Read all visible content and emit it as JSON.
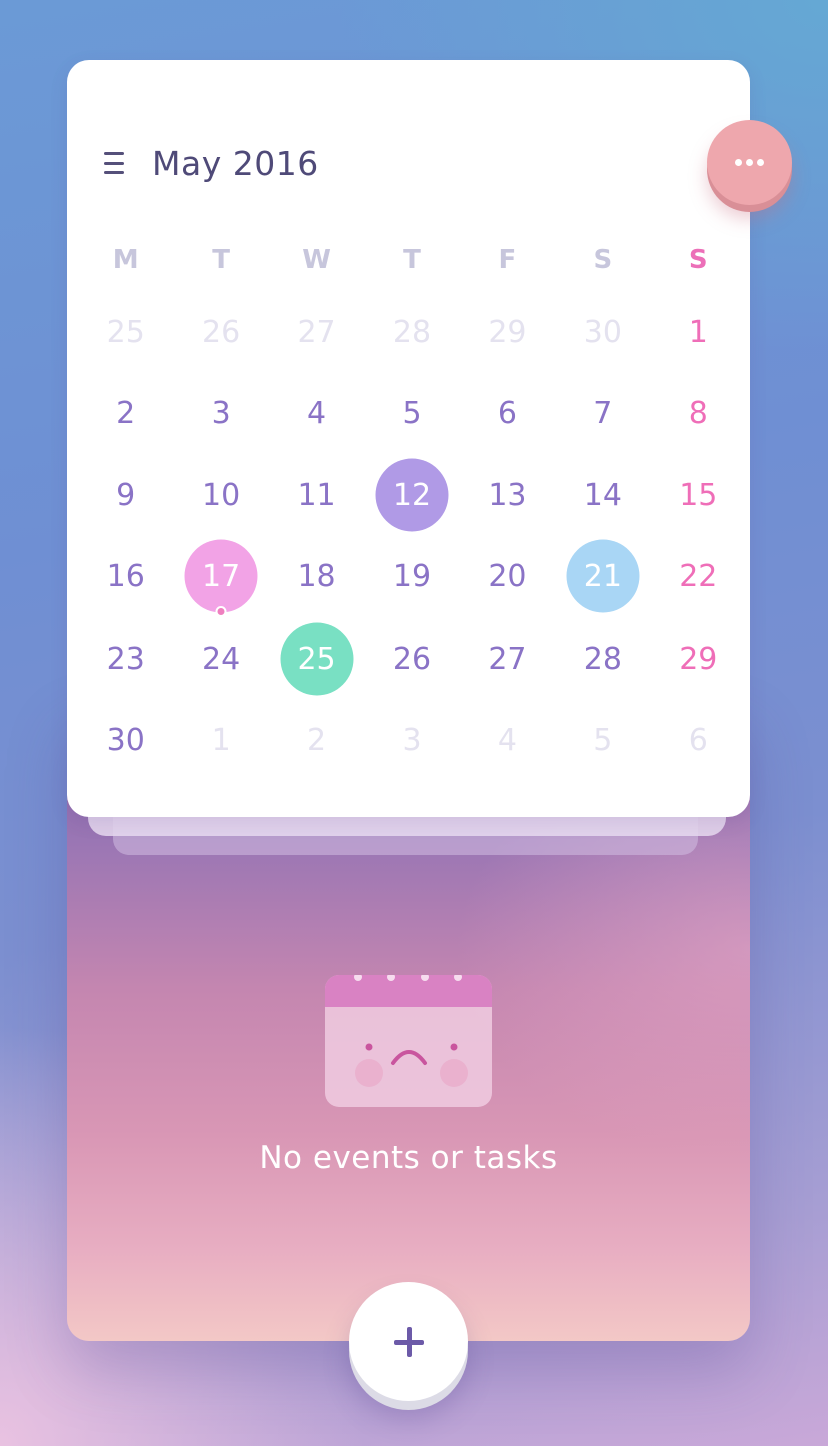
{
  "calendar": {
    "month_title": "May 2016",
    "weekdays": [
      "M",
      "T",
      "W",
      "T",
      "F",
      "S",
      "S"
    ],
    "weeks": [
      [
        {
          "d": "25",
          "muted": true
        },
        {
          "d": "26",
          "muted": true
        },
        {
          "d": "27",
          "muted": true
        },
        {
          "d": "28",
          "muted": true
        },
        {
          "d": "29",
          "muted": true
        },
        {
          "d": "30",
          "muted": true
        },
        {
          "d": "1"
        }
      ],
      [
        {
          "d": "2"
        },
        {
          "d": "3"
        },
        {
          "d": "4"
        },
        {
          "d": "5"
        },
        {
          "d": "6"
        },
        {
          "d": "7"
        },
        {
          "d": "8"
        }
      ],
      [
        {
          "d": "9"
        },
        {
          "d": "10"
        },
        {
          "d": "11"
        },
        {
          "d": "12",
          "highlight": "#b09ae6"
        },
        {
          "d": "13"
        },
        {
          "d": "14"
        },
        {
          "d": "15"
        }
      ],
      [
        {
          "d": "16"
        },
        {
          "d": "17",
          "highlight": "#f2a3e6",
          "event_dot": true
        },
        {
          "d": "18"
        },
        {
          "d": "19"
        },
        {
          "d": "20"
        },
        {
          "d": "21",
          "highlight": "#a9d6f5"
        },
        {
          "d": "22"
        }
      ],
      [
        {
          "d": "23"
        },
        {
          "d": "24"
        },
        {
          "d": "25",
          "highlight": "#79e0c3"
        },
        {
          "d": "26"
        },
        {
          "d": "27"
        },
        {
          "d": "28"
        },
        {
          "d": "29"
        }
      ],
      [
        {
          "d": "30"
        },
        {
          "d": "1",
          "muted": true
        },
        {
          "d": "2",
          "muted": true
        },
        {
          "d": "3",
          "muted": true
        },
        {
          "d": "4",
          "muted": true
        },
        {
          "d": "5",
          "muted": true
        },
        {
          "d": "6",
          "muted": true
        }
      ]
    ]
  },
  "icons": {
    "menu": "hamburger-menu-icon",
    "more": "more-horizontal-icon",
    "add": "plus-icon",
    "empty": "sad-calendar-illustration"
  },
  "empty_state": {
    "text": "No events or tasks"
  },
  "colors": {
    "accent_purple": "#8a73c6",
    "sunday_pink": "#ef6eb8",
    "more_button": "#eea7ad"
  }
}
